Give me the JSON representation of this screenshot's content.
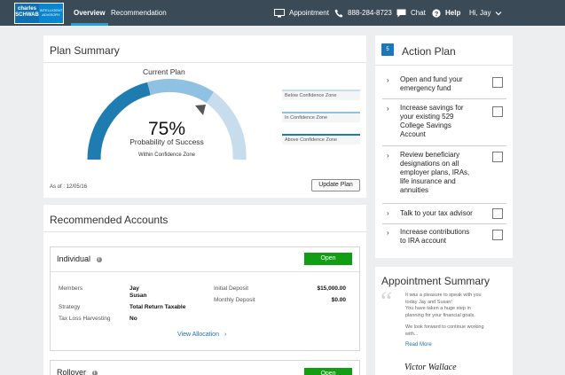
{
  "nav": {
    "logo_line1": "charles",
    "logo_line2": "SCHWAB",
    "logo_sub1": "INTELLIGENT",
    "logo_sub2": "ADVISORY",
    "tabs": [
      {
        "label": "Overview"
      },
      {
        "label": "Recommendation"
      }
    ],
    "appointment": "Appointment",
    "phone": "888-284-8723",
    "chat": "Chat",
    "help": "Help",
    "user": "Hi, Jay",
    "accent": "#26a0da"
  },
  "plan_summary": {
    "title": "Plan Summary",
    "subtitle": "Current Plan",
    "percent": "75%",
    "probability_label": "Probability of Success",
    "zone_text": "Within Confidence Zone",
    "gauge_value_fraction": 0.75,
    "legend": [
      {
        "label": "Below Confidence Zone",
        "color": "#c7dcec"
      },
      {
        "label": "In Confidence Zone",
        "color": "#8fc1e3"
      },
      {
        "label": "Above Confidence Zone",
        "color": "#1f7cb0"
      }
    ],
    "as_of": "As of : 12/05/16",
    "update_button": "Update Plan"
  },
  "recommended": {
    "title": "Recommended Accounts",
    "accounts": [
      {
        "name": "Individual",
        "open_label": "Open",
        "members_label": "Members",
        "members": [
          "Jay",
          "Susan"
        ],
        "strategy_label": "Strategy",
        "strategy": "Total Return Taxable",
        "tlh_label": "Tax Loss Harvesting",
        "tlh": "No",
        "initial_label": "Initial Deposit",
        "initial": "$15,000.00",
        "monthly_label": "Monthly Deposit",
        "monthly": "$0.00",
        "view_allocation": "View Allocation"
      },
      {
        "name": "Rollover",
        "open_label": "Open"
      }
    ]
  },
  "action_plan": {
    "badge": "5",
    "title": "Action Plan",
    "items": [
      {
        "lines": [
          "Open and fund your",
          "emergency fund"
        ]
      },
      {
        "lines": [
          "Increase savings for",
          "your existing 529",
          "College Savings",
          "Account"
        ]
      },
      {
        "lines": [
          "Review beneficiary",
          "designations on all",
          "employer plans, IRAs,",
          "life insurance and",
          "annuities"
        ]
      },
      {
        "lines": [
          "Talk to your tax advisor"
        ]
      },
      {
        "lines": [
          "Increase contributions",
          "to IRA account"
        ]
      }
    ]
  },
  "appointment_summary": {
    "title": "Appointment Summary",
    "paragraph1": [
      "It was a pleasure to speak with you",
      "today Jay and Susan!",
      "You have taken a huge step in",
      "planning for your financial goals."
    ],
    "paragraph2": [
      "We look forward to continue working",
      "with..."
    ],
    "read_more": "Read More",
    "signature": "Victor Wallace"
  }
}
